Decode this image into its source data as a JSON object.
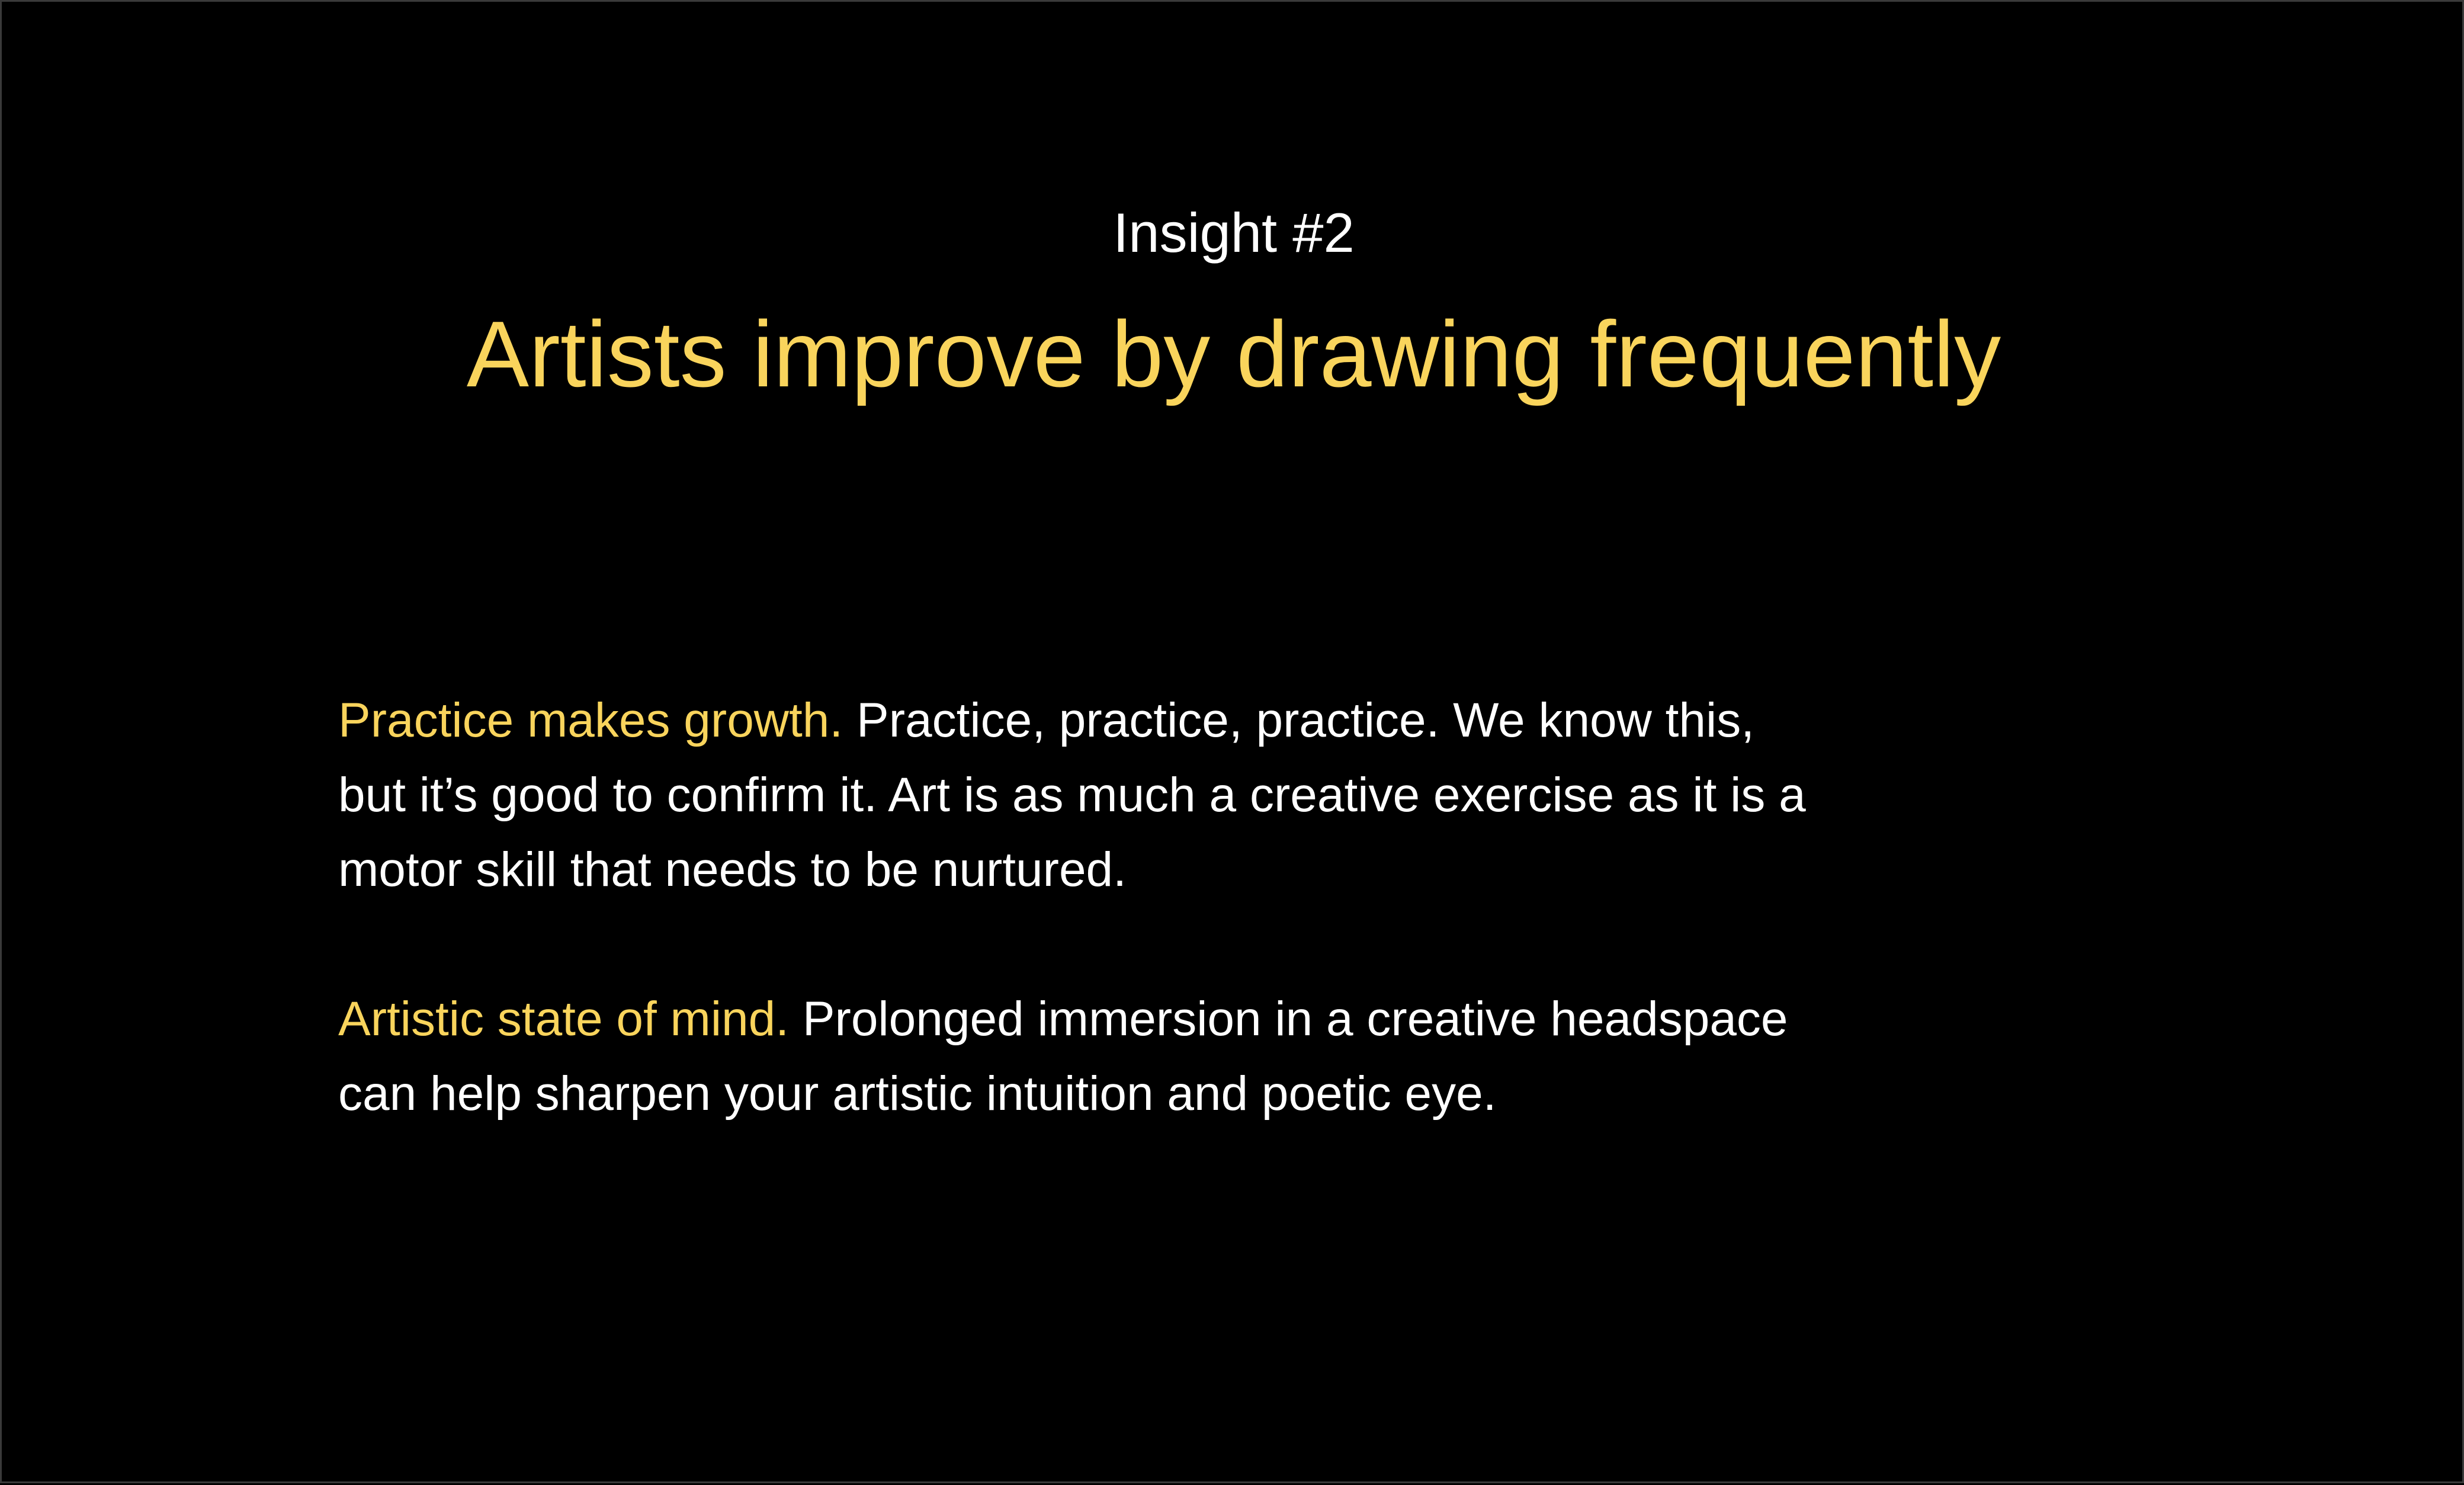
{
  "slide": {
    "eyebrow": "Insight #2",
    "headline": "Artists improve by drawing frequently",
    "paragraphs": [
      {
        "lead": "Practice makes growth.",
        "text": "Practice, practice, practice. We know this, but it’s good to confirm it. Art is as much a creative exercise as it is a motor skill that needs to be nurtured."
      },
      {
        "lead": "Artistic state of mind.",
        "text": "Prolonged immersion in a creative headspace can help sharpen your artistic intuition and poetic eye."
      }
    ]
  },
  "colors": {
    "background": "#000000",
    "accent": "#f9d45c",
    "text": "#ffffff"
  }
}
